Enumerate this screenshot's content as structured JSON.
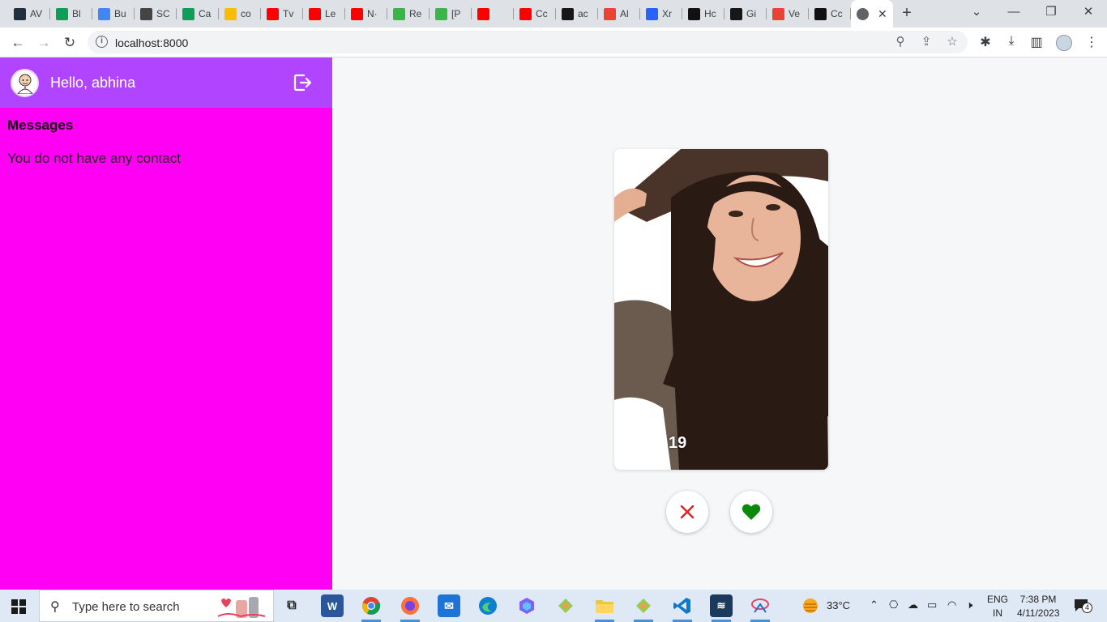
{
  "browser": {
    "tabs": [
      {
        "label": "AV",
        "icon": "aws-icon",
        "color": "#232f3e"
      },
      {
        "label": "Bl",
        "icon": "sheets-icon",
        "color": "#0f9d58"
      },
      {
        "label": "Bu",
        "icon": "cloud-icon",
        "color": "#4285f4"
      },
      {
        "label": "SC",
        "icon": "document-icon",
        "color": "#444444"
      },
      {
        "label": "Ca",
        "icon": "sheets-icon",
        "color": "#0f9d58"
      },
      {
        "label": "co",
        "icon": "drive-icon",
        "color": "#fbbc04"
      },
      {
        "label": "Tv",
        "icon": "youtube-icon",
        "color": "#ff0000"
      },
      {
        "label": "Le",
        "icon": "youtube-icon",
        "color": "#ff0000"
      },
      {
        "label": "N·",
        "icon": "youtube-icon",
        "color": "#ff0000"
      },
      {
        "label": "Re",
        "icon": "leaf-icon",
        "color": "#3ab54a"
      },
      {
        "label": "[P",
        "icon": "leaf-icon",
        "color": "#3ab54a"
      },
      {
        "label": "",
        "icon": "youtube-emoji-icon",
        "color": "#ff0000"
      },
      {
        "label": "Cc",
        "icon": "youtube-icon",
        "color": "#ff0000"
      },
      {
        "label": "ac",
        "icon": "github-icon",
        "color": "#181717"
      },
      {
        "label": "Al",
        "icon": "gmail-icon",
        "color": "#ea4335"
      },
      {
        "label": "Xr",
        "icon": "doc-blue-icon",
        "color": "#2962ff"
      },
      {
        "label": "Hc",
        "icon": "c-icon",
        "color": "#111111"
      },
      {
        "label": "Gi",
        "icon": "github-icon",
        "color": "#181717"
      },
      {
        "label": "Ve",
        "icon": "gmail-icon",
        "color": "#ea4335"
      },
      {
        "label": "Cc",
        "icon": "c-icon",
        "color": "#111111"
      }
    ],
    "active_tab": {
      "label": "",
      "icon": "globe-icon"
    },
    "url": "localhost:8000"
  },
  "app": {
    "greeting": "Hello, abhina",
    "messages_title": "Messages",
    "empty_contacts": "You do not have any contact",
    "card": {
      "age": "19"
    },
    "colors": {
      "sidebar": "#ff00f4",
      "header": "#b145ff",
      "reject": "#e02020",
      "like": "#0a8a0a"
    }
  },
  "taskbar": {
    "search_placeholder": "Type here to search",
    "weather": "33°C",
    "lang": "ENG",
    "region": "IN",
    "time": "7:38 PM",
    "date": "4/11/2023",
    "notifications": "4"
  }
}
